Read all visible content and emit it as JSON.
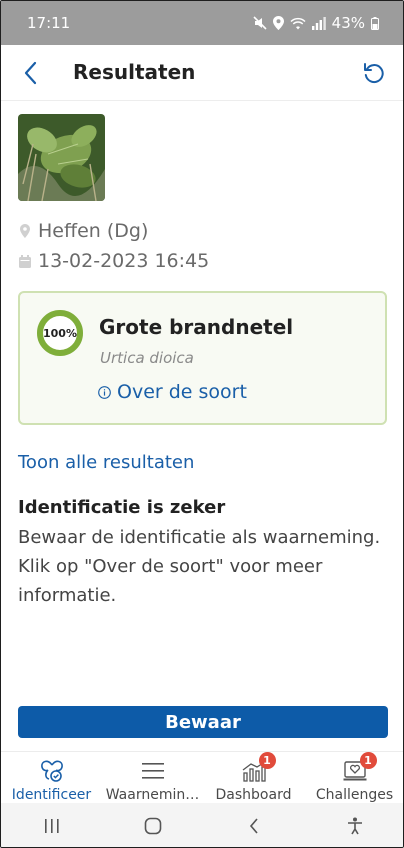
{
  "status_bar": {
    "time": "17:11",
    "battery_percent": "43%",
    "icons": [
      "mute-icon",
      "location-icon",
      "wifi-icon",
      "signal-icon",
      "battery-icon"
    ]
  },
  "header": {
    "title": "Resultaten",
    "back_icon": "chevron-left-icon",
    "reset_icon": "refresh-icon"
  },
  "observation": {
    "location": "Heffen (Dg)",
    "datetime": "13-02-2023 16:45"
  },
  "result": {
    "confidence_label": "100%",
    "confidence_value": 1.0,
    "common_name": "Grote brandnetel",
    "scientific_name": "Urtica dioica",
    "about_link": "Over de soort"
  },
  "links": {
    "all_results": "Toon alle resultaten"
  },
  "identification": {
    "title": "Identificatie is zeker",
    "text": "Bewaar de identificatie als waarneming. Klik op \"Over de soort\" voor meer informatie."
  },
  "actions": {
    "save_label": "Bewaar"
  },
  "tabs": [
    {
      "label": "Identificeer",
      "icon": "identify-icon",
      "active": true
    },
    {
      "label": "Waarnemin…",
      "icon": "list-icon",
      "active": false
    },
    {
      "label": "Dashboard",
      "icon": "dashboard-icon",
      "badge": "1",
      "active": false
    },
    {
      "label": "Challenges",
      "icon": "challenges-icon",
      "badge": "1",
      "active": false
    }
  ],
  "colors": {
    "accent": "#1a5fa8",
    "primary_button": "#0d5ba8",
    "confidence_green": "#7fae3a",
    "card_border": "#cfe1b2",
    "badge": "#e14b3b",
    "status_bar": "#9c9c9c"
  }
}
